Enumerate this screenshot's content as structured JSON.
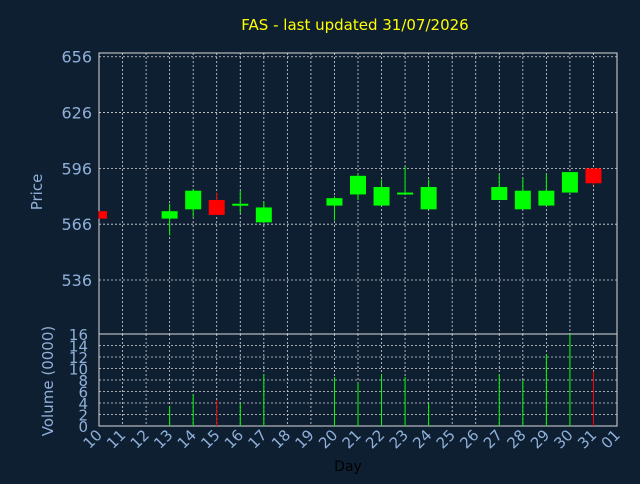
{
  "chart_data": {
    "type": "candlestick",
    "title": "FAS - last updated 31/07/2026",
    "price_ylabel": "Price",
    "volume_ylabel": "Volume (0000)",
    "xlabel": "Day",
    "x_ticks": [
      "10",
      "11",
      "12",
      "13",
      "14",
      "15",
      "16",
      "17",
      "18",
      "19",
      "20",
      "21",
      "22",
      "23",
      "24",
      "25",
      "26",
      "27",
      "28",
      "29",
      "30",
      "31",
      "01"
    ],
    "price_ticks": [
      "656",
      "626",
      "596",
      "566",
      "536"
    ],
    "price_ylim": [
      507,
      658
    ],
    "volume_ticks": [
      "16",
      "14",
      "12",
      "10",
      "8",
      "6",
      "4",
      "2",
      "0"
    ],
    "volume_ylim": [
      0,
      16
    ],
    "candles": [
      {
        "day": "10",
        "open": 573,
        "close": 569,
        "high": 573,
        "low": 569,
        "volume": 0
      },
      {
        "day": "13",
        "open": 569,
        "close": 573,
        "high": 577,
        "low": 560,
        "volume": 3.5
      },
      {
        "day": "14",
        "open": 574,
        "close": 584,
        "high": 585,
        "low": 570,
        "volume": 5.5
      },
      {
        "day": "15",
        "open": 579,
        "close": 571,
        "high": 583,
        "low": 571,
        "volume": 4.5
      },
      {
        "day": "16",
        "open": 576,
        "close": 577,
        "high": 584,
        "low": 572,
        "volume": 4
      },
      {
        "day": "17",
        "open": 567,
        "close": 575,
        "high": 578,
        "low": 567,
        "volume": 9
      },
      {
        "day": "20",
        "open": 576,
        "close": 580,
        "high": 581,
        "low": 568,
        "volume": 8.5
      },
      {
        "day": "21",
        "open": 582,
        "close": 592,
        "high": 593,
        "low": 579,
        "volume": 7.5
      },
      {
        "day": "22",
        "open": 576,
        "close": 586,
        "high": 590,
        "low": 576,
        "volume": 9
      },
      {
        "day": "23",
        "open": 582,
        "close": 583,
        "high": 597,
        "low": 582,
        "volume": 8.5
      },
      {
        "day": "24",
        "open": 574,
        "close": 586,
        "high": 590,
        "low": 574,
        "volume": 4
      },
      {
        "day": "27",
        "open": 579,
        "close": 586,
        "high": 593,
        "low": 579,
        "volume": 9
      },
      {
        "day": "28",
        "open": 574,
        "close": 584,
        "high": 591,
        "low": 574,
        "volume": 8
      },
      {
        "day": "29",
        "open": 576,
        "close": 584,
        "high": 593,
        "low": 576,
        "volume": 12.5
      },
      {
        "day": "30",
        "open": 583,
        "close": 594,
        "high": 594,
        "low": 583,
        "volume": 16
      },
      {
        "day": "31",
        "open": 596,
        "close": 588,
        "high": 596,
        "low": 587,
        "volume": 9.5
      }
    ]
  },
  "colors": {
    "background": "#0f1f32",
    "title": "#ffff00",
    "axis_text": "#8fb0d8",
    "grid": "#d8d8d8",
    "up": "#00ff00",
    "down": "#ff0000"
  }
}
